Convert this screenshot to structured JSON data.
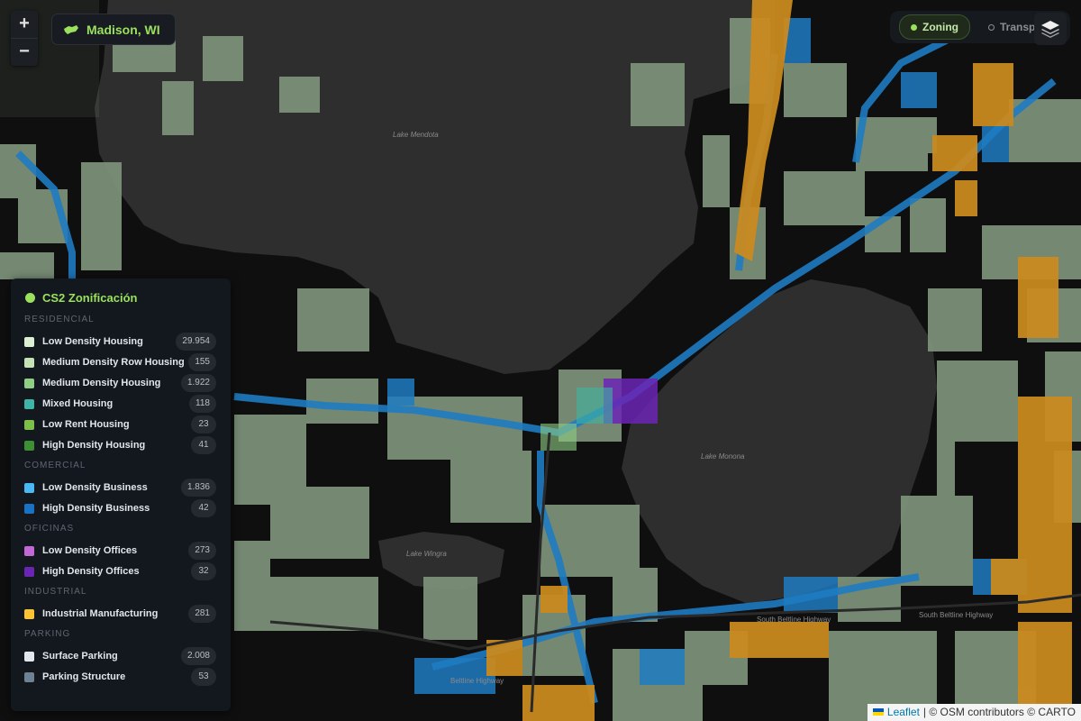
{
  "map": {
    "lake_labels": [
      "Lake Mendota",
      "Lake Monona",
      "Lake Wingra"
    ],
    "road_labels": [
      "South Beltline Highway",
      "South Beltline Highway",
      "Beltline Highway"
    ]
  },
  "zoom": {
    "in_label": "+",
    "out_label": "−"
  },
  "city_badge": {
    "icon": "map-pin-icon",
    "label": "Madison, WI"
  },
  "modes": [
    {
      "label": "Zoning",
      "active": true
    },
    {
      "label": "Transp",
      "active": false
    }
  ],
  "layers_button": {
    "icon": "layers-icon"
  },
  "legend": {
    "title": "CS2 Zonificación",
    "sections": [
      {
        "title": "RESIDENCIAL",
        "items": [
          {
            "label": "Low Density Housing",
            "count": "29.954",
            "color": "#dcefd2"
          },
          {
            "label": "Medium Density Row Housing",
            "count": "155",
            "color": "#c4e2b3"
          },
          {
            "label": "Medium Density Housing",
            "count": "1.922",
            "color": "#8fcf85"
          },
          {
            "label": "Mixed Housing",
            "count": "118",
            "color": "#3fb5a3"
          },
          {
            "label": "Low Rent Housing",
            "count": "23",
            "color": "#7cc047"
          },
          {
            "label": "High Density Housing",
            "count": "41",
            "color": "#3e8e34"
          }
        ]
      },
      {
        "title": "COMERCIAL",
        "items": [
          {
            "label": "Low Density Business",
            "count": "1.836",
            "color": "#4ab8f2"
          },
          {
            "label": "High Density Business",
            "count": "42",
            "color": "#1a72c4"
          }
        ]
      },
      {
        "title": "OFICINAS",
        "items": [
          {
            "label": "Low Density Offices",
            "count": "273",
            "color": "#c268d6"
          },
          {
            "label": "High Density Offices",
            "count": "32",
            "color": "#6b25b5"
          }
        ]
      },
      {
        "title": "INDUSTRIAL",
        "items": [
          {
            "label": "Industrial Manufacturing",
            "count": "281",
            "color": "#ffc233"
          }
        ]
      },
      {
        "title": "PARKING",
        "items": [
          {
            "label": "Surface Parking",
            "count": "2.008",
            "color": "#e3e6ea"
          },
          {
            "label": "Parking Structure",
            "count": "53",
            "color": "#6f8292"
          }
        ]
      }
    ]
  },
  "attribution": {
    "flag_icon": "ukraine-flag-icon",
    "link": "Leaflet",
    "text": "| © OSM contributors © CARTO"
  },
  "colors": {
    "land": "#0f0f0f",
    "water": "#2e2e2e",
    "residential": "#7a8f78",
    "business": "#1f7bc2",
    "industrial": "#c98a1f",
    "accent": "#9be15d"
  }
}
